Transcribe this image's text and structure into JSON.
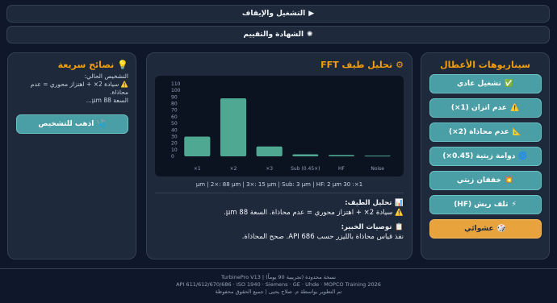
{
  "top_buttons": {
    "play_label": "التشغيل والإيقاف",
    "play_icon": "▶",
    "score_label": "الشهادة والتقييم",
    "score_icon": "✺"
  },
  "scenarios": {
    "title": "سيناريوهات الأعطال",
    "items": [
      {
        "label": "تشغيل عادي",
        "icon": "✅"
      },
      {
        "label": "عدم اتزان (1×)",
        "icon": "⚠️"
      },
      {
        "label": "عدم محاذاة (2×)",
        "icon": "📐"
      },
      {
        "label": "دوامة زيتية (0.45×)",
        "icon": "🌀"
      },
      {
        "label": "خفقان زيتي",
        "icon": "💥"
      },
      {
        "label": "تلف ريش (HF)",
        "icon": "⚡"
      },
      {
        "label": "عشوائي",
        "icon": "🎲"
      }
    ]
  },
  "fft": {
    "title": "تحليل طيف FFT",
    "title_icon": "⚙",
    "readout": "1×: 30 μm | 2×: 88 μm | 3×: 15 μm | Sub: 3 μm | HF: 2 μm",
    "analysis_head": "تحليل الطيف:",
    "analysis_icon": "📊",
    "analysis_body": "سيادة 2× + اهتزاز محوري = عدم محاذاة. السعة 88 μm.",
    "warn_icon": "⚠️",
    "expert_head": "توصيات الخبير:",
    "expert_icon": "📋",
    "expert_body": "نفذ قياس محاذاة بالليزر حسب API 686. صحح المحاذاة."
  },
  "chart_data": {
    "type": "bar",
    "categories": [
      "1×",
      "2×",
      "3×",
      "Sub (0.45×)",
      "HF",
      "Noise"
    ],
    "values": [
      30,
      88,
      15,
      3,
      2,
      1
    ],
    "ylim": [
      0,
      110
    ],
    "yticks": [
      0,
      10,
      20,
      30,
      40,
      50,
      60,
      70,
      80,
      90,
      100,
      110
    ],
    "grid": false,
    "bar_color": "#4fa892"
  },
  "tips": {
    "title": "نصائح سريعة",
    "title_icon": "💡",
    "line1": "التشخيص الحالي:",
    "line2": "⚠️ سيادة 2× + اهتزاز محوري = عدم محاذاة.",
    "line3": "السعة 88 μm...",
    "button_label": "اذهب للتشخيص",
    "button_icon": "🩺"
  },
  "footer": {
    "line1": "TurbinePro V13 | نسخة محدودة (تجريبية 90 يوماً)",
    "line2": "API 611/612/670/686 · ISO 1940 · Siemens · GE · Uhde · MOPCO Training 2026",
    "line3": "تم التطوير بواسطة م. صلاح يحيى | جميع الحقوق محفوظة"
  }
}
